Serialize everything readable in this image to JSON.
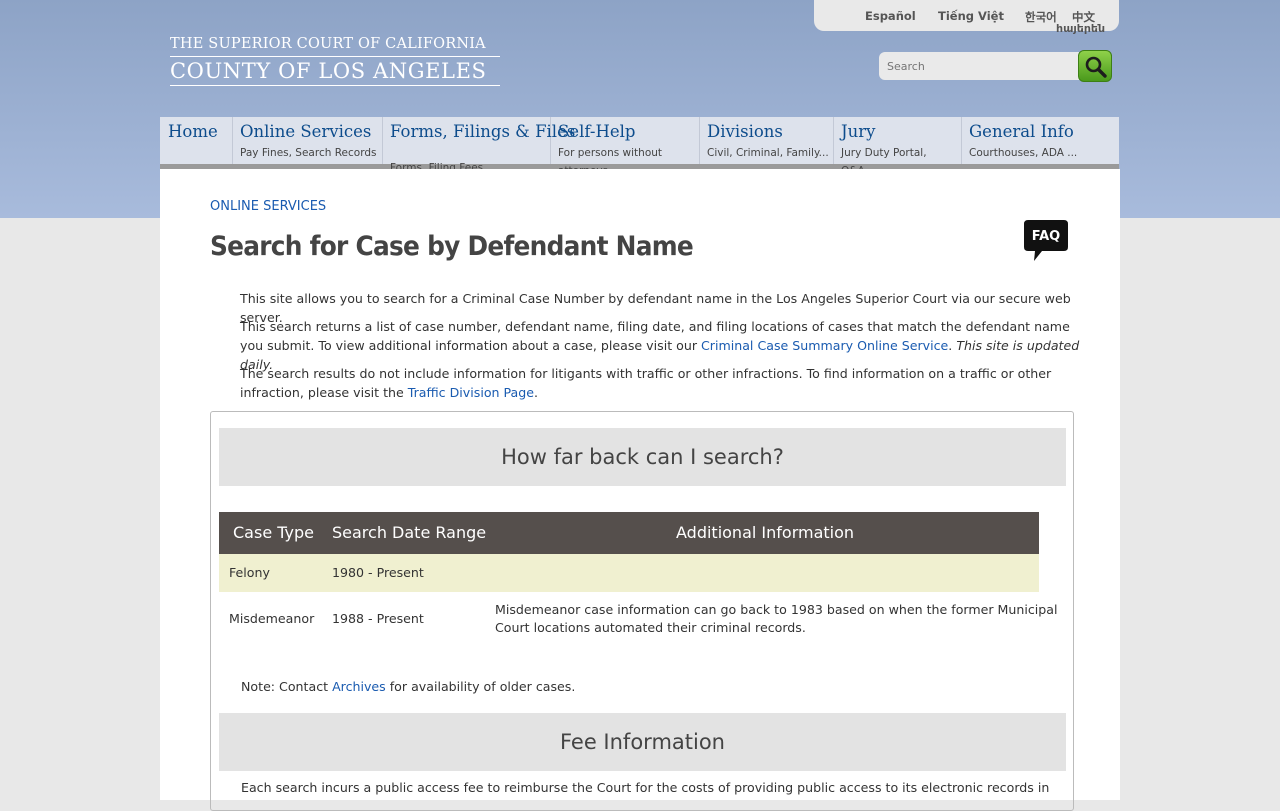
{
  "languages": [
    "Español",
    "Tiếng Việt",
    "한국어",
    "中文",
    "հայերեն"
  ],
  "logo": {
    "line1": "THE SUPERIOR COURT OF CALIFORNIA",
    "line2": "COUNTY OF LOS ANGELES"
  },
  "search": {
    "placeholder": "Search",
    "icon": "magnifier-icon"
  },
  "nav": [
    {
      "title": "Home",
      "sub": ""
    },
    {
      "title": "Online Services",
      "sub": "Pay Fines, Search Records ..."
    },
    {
      "title": "Forms, Filings & Files",
      "sub": "Forms, Filing Fees ..."
    },
    {
      "title": "Self-Help",
      "sub": "For persons without attorneys ..."
    },
    {
      "title": "Divisions",
      "sub": "Civil, Criminal, Family..."
    },
    {
      "title": "Jury",
      "sub": "Jury Duty Portal, Q&A ..."
    },
    {
      "title": "General Info",
      "sub": "Courthouses, ADA ..."
    }
  ],
  "breadcrumb": "ONLINE SERVICES",
  "page_title": "Search for Case by Defendant Name",
  "faq_label": "FAQ",
  "intro": {
    "p1": "This site allows you to search for a Criminal Case Number by defendant name in the Los Angeles Superior Court via our secure web server.",
    "p2_a": "This search returns a list of case number, defendant name, filing date, and filing locations of cases that match the defendant name you submit. To view additional information about a case, please visit our ",
    "p2_link": "Criminal Case Summary Online Service",
    "p2_b": ". ",
    "p2_italic": "This site is updated daily.",
    "p3_a": "The search results do not include information for litigants with traffic or other infractions. To find information on a traffic or other infraction, please visit the ",
    "p3_link": "Traffic Division Page",
    "p3_b": "."
  },
  "search_back": {
    "heading": "How far back can I search?",
    "columns": [
      "Case Type",
      "Search Date Range",
      "Additional Information"
    ],
    "rows": [
      {
        "type": "Felony",
        "range": "1980 - Present",
        "info1": "",
        "info2": ""
      },
      {
        "type": "Misdemeanor",
        "range": "1988 - Present",
        "info1": "Misdemeanor case information can go back to 1983 based on when the former Municipal",
        "info2": "Court locations automated their criminal records."
      }
    ],
    "note_a": "Note: Contact ",
    "note_link": "Archives",
    "note_b": " for availability of older cases."
  },
  "fee": {
    "heading": "Fee Information",
    "text": "Each search incurs a public access fee to reimburse the Court for the costs of providing public access to its electronic records in"
  },
  "colors": {
    "nav_text": "#0d4c8c",
    "link": "#1a5bb0",
    "table_header": "#554f4c",
    "row_highlight": "#f0f0d0",
    "search_button": "#6cb832"
  }
}
